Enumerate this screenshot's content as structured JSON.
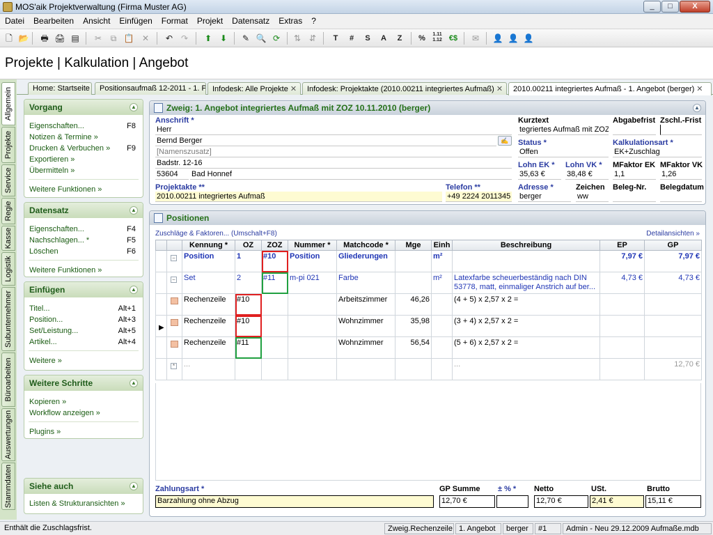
{
  "window": {
    "title": "MOS'aik Projektverwaltung (Firma Muster AG)",
    "controls": [
      "_",
      "□",
      "X"
    ]
  },
  "menu": [
    "Datei",
    "Bearbeiten",
    "Ansicht",
    "Einfügen",
    "Format",
    "Projekt",
    "Datensatz",
    "Extras",
    "?"
  ],
  "toolbar": {
    "text_buttons": [
      "T",
      "#",
      "S",
      "A",
      "Z",
      "%",
      "1.11\n1.12",
      "€$"
    ]
  },
  "header": {
    "title": "Projekte | Kalkulation | Angebot"
  },
  "vtabs": [
    "Allgemein",
    "Projekte",
    "Service",
    "Regie",
    "Kasse",
    "Logistik",
    "Subunternehmer",
    "Büroarbeiten",
    "Auswertungen",
    "Stammdaten"
  ],
  "tabs": [
    {
      "label": "Home: Startseite",
      "closable": false
    },
    {
      "label": "Positionsaufmaß 12-2011 - 1. P",
      "closable": false
    },
    {
      "label": "Infodesk: Alle Projekte",
      "closable": true
    },
    {
      "label": "Infodesk: Projektakte (2010.00211 integriertes Aufmaß)",
      "closable": true
    },
    {
      "label": "2010.00211 integriertes Aufmaß - 1. Angebot (berger)",
      "closable": true
    }
  ],
  "sidebar": {
    "vorgang": {
      "title": "Vorgang",
      "items": [
        {
          "label": "Eigenschaften...",
          "key": "F8"
        },
        {
          "label": "Notizen & Termine »",
          "key": ""
        },
        {
          "label": "Drucken & Verbuchen »",
          "key": "F9"
        },
        {
          "label": "Exportieren »",
          "key": ""
        },
        {
          "label": "Übermitteln »",
          "key": ""
        }
      ],
      "more": "Weitere Funktionen »"
    },
    "datensatz": {
      "title": "Datensatz",
      "items": [
        {
          "label": "Eigenschaften...",
          "key": "F4"
        },
        {
          "label": "Nachschlagen... *",
          "key": "F5"
        },
        {
          "label": "Löschen",
          "key": "F6"
        }
      ],
      "more": "Weitere Funktionen »"
    },
    "einfuegen": {
      "title": "Einfügen",
      "items": [
        {
          "label": "Titel...",
          "key": "Alt+1"
        },
        {
          "label": "Position...",
          "key": "Alt+3"
        },
        {
          "label": "Set/Leistung...",
          "key": "Alt+5"
        },
        {
          "label": "Artikel...",
          "key": "Alt+4"
        }
      ],
      "more": "Weitere »"
    },
    "weitere": {
      "title": "Weitere Schritte",
      "items": [
        {
          "label": "Kopieren »",
          "key": ""
        },
        {
          "label": "Workflow anzeigen »",
          "key": ""
        }
      ],
      "more": "Plugins »"
    },
    "siehe": {
      "title": "Siehe auch",
      "items": [
        {
          "label": "Listen & Strukturansichten »",
          "key": ""
        }
      ]
    }
  },
  "zweig": {
    "title": "Zweig: 1. Angebot  integriertes Aufmaß mit ZOZ 10.11.2010 (berger)",
    "anschrift_label": "Anschrift *",
    "anrede": "Herr",
    "name": "Bernd Berger",
    "namenszusatz": "[Namenszusatz]",
    "strasse": "Badstr. 12-16",
    "plz": "53604",
    "ort": "Bad Honnef",
    "projektakte_label": "Projektakte **",
    "projektakte": "2010.00211 integriertes Aufmaß",
    "telefon_label": "Telefon **",
    "telefon": "+49 2224 2011345",
    "kurztext_label": "Kurztext",
    "kurztext": "tegriertes Aufmaß mit ZOZ",
    "abgabefrist_label": "Abgabefrist",
    "abgabefrist": "",
    "zschl_frist_label": "Zschl.-Frist",
    "zschl_frist": "",
    "status_label": "Status *",
    "status": "Offen",
    "kalkart_label": "Kalkulationsart *",
    "kalkart": "EK+Zuschlag",
    "lohn_ek_label": "Lohn EK *",
    "lohn_ek": "35,63 €",
    "lohn_vk_label": "Lohn VK *",
    "lohn_vk": "38,48 €",
    "mfaktor_ek_label": "MFaktor EK",
    "mfaktor_ek": "1,1",
    "mfaktor_vk_label": "MFaktor VK",
    "mfaktor_vk": "1,26",
    "adresse_label": "Adresse *",
    "adresse": "berger",
    "zeichen_label": "Zeichen",
    "zeichen": "ww",
    "belegnr_label": "Beleg-Nr.",
    "belegnr": "",
    "belegdatum_label": "Belegdatum",
    "belegdatum": ""
  },
  "positionen": {
    "title": "Positionen",
    "zuschlaege_link": "Zuschläge & Faktoren... (Umschalt+F8)",
    "detail_link": "Detailansichten »",
    "columns": [
      "Kennung *",
      "OZ",
      "ZOZ",
      "Nummer *",
      "Matchcode *",
      "Mge",
      "Einh",
      "Beschreibung",
      "EP",
      "GP"
    ],
    "rows": [
      {
        "kennung": "Position",
        "oz": "1",
        "zoz": "#10",
        "nummer": "Position",
        "matchcode": "Gliederungen",
        "mge": "",
        "einh": "m²",
        "beschreibung": "",
        "ep": "7,97 €",
        "gp": "7,97 €"
      },
      {
        "kennung": "Set",
        "oz": "2",
        "zoz": "#11",
        "nummer": "m-pi 021",
        "matchcode": "Farbe",
        "mge": "",
        "einh": "m²",
        "beschreibung": "Latexfarbe scheuerbeständig nach DIN 53778, matt, einmaliger Anstrich auf ber...",
        "ep": "4,73 €",
        "gp": "4,73 €"
      },
      {
        "kennung": "Rechenzeile",
        "oz": "#10",
        "zoz": "",
        "nummer": "",
        "matchcode": "Arbeitszimmer",
        "mge": "46,26",
        "einh": "",
        "beschreibung": "(4 + 5) x 2,57 x 2 =",
        "ep": "",
        "gp": ""
      },
      {
        "kennung": "Rechenzeile",
        "oz": "#10",
        "zoz": "",
        "nummer": "",
        "matchcode": "Wohnzimmer",
        "mge": "35,98",
        "einh": "",
        "beschreibung": "(3 + 4) x 2,57 x 2 =",
        "ep": "",
        "gp": ""
      },
      {
        "kennung": "Rechenzeile",
        "oz": "#11",
        "zoz": "",
        "nummer": "",
        "matchcode": "Wohnzimmer",
        "mge": "56,54",
        "einh": "",
        "beschreibung": "(5 + 6) x 2,57 x 2 =",
        "ep": "",
        "gp": ""
      },
      {
        "kennung": "...",
        "oz": "",
        "zoz": "",
        "nummer": "",
        "matchcode": "",
        "mge": "",
        "einh": "",
        "beschreibung": "...",
        "ep": "",
        "gp": "12,70 €"
      }
    ]
  },
  "footer": {
    "zahlungsart_label": "Zahlungsart *",
    "zahlungsart": "Barzahlung ohne Abzug",
    "gp_summe_label": "GP Summe",
    "gp_summe": "12,70 €",
    "pm_label": "± % *",
    "pm": "",
    "netto_label": "Netto",
    "netto": "12,70 €",
    "ust_label": "USt.",
    "ust": "2,41 €",
    "brutto_label": "Brutto",
    "brutto": "15,11 €"
  },
  "status": {
    "message": "Enthält die Zuschlagsfrist.",
    "context": "Zweig.Rechenzeile",
    "zweig": "1. Angebot",
    "user": "berger",
    "record": "#1",
    "db": "Admin - Neu 29.12.2009 Aufmaße.mdb"
  },
  "colors": {
    "green_header": "#257019",
    "label_blue": "#2a3ba1",
    "yellow_field": "#fefbd2",
    "red_box": "#e02020",
    "green_box": "#20a040"
  }
}
